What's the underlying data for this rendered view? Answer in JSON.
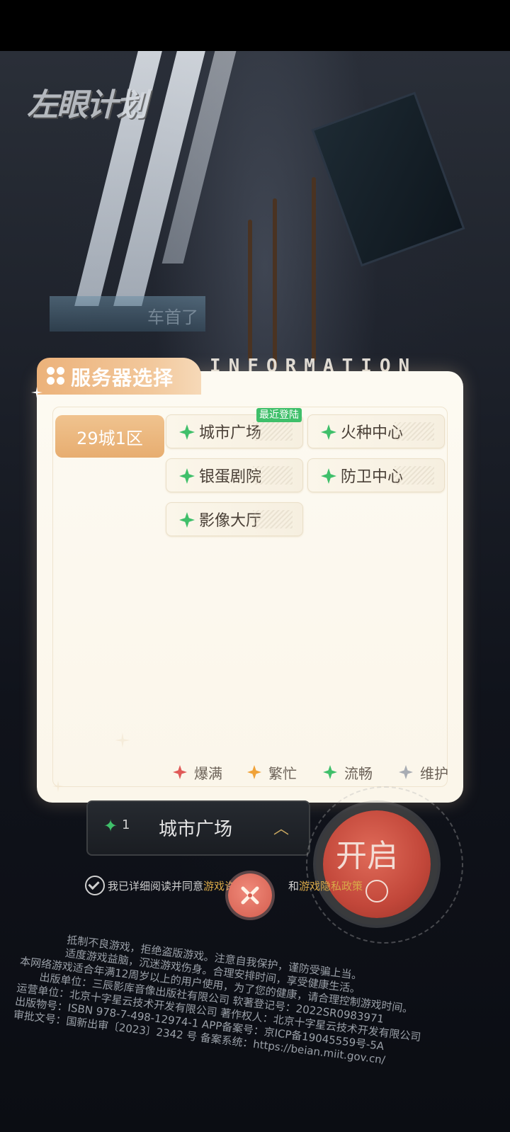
{
  "background": {
    "logo_text": "左眼计划",
    "sign_text": "车首了",
    "info_banner": "INFORMATION"
  },
  "dialog": {
    "title": "服务器选择",
    "region_tab": "29城1区",
    "recent_badge": "最近登陆",
    "servers": [
      {
        "name": "城市广场",
        "status": "流畅"
      },
      {
        "name": "火种中心",
        "status": "流畅"
      },
      {
        "name": "银蛋剧院",
        "status": "流畅"
      },
      {
        "name": "防卫中心",
        "status": "流畅"
      },
      {
        "name": "影像大厅",
        "status": "流畅"
      }
    ],
    "legend": [
      {
        "label": "爆满",
        "color": "#e05a58"
      },
      {
        "label": "繁忙",
        "color": "#f0a238"
      },
      {
        "label": "流畅",
        "color": "#3fbf6a"
      },
      {
        "label": "维护",
        "color": "#a8acb3"
      }
    ]
  },
  "game_ui": {
    "selected_server_num": "1",
    "selected_server": "城市广场",
    "start_button": "开启",
    "consent_prefix": "我已详细阅读并同意",
    "consent_link1": "游戏许可",
    "consent_mid": "和",
    "consent_link2": "游戏隐私政策"
  },
  "footer": {
    "lines": [
      "抵制不良游戏，拒绝盗版游戏。注意自我保护，谨防受骗上当。",
      "适度游戏益脑，沉迷游戏伤身。合理安排时间，享受健康生活。",
      "本网络游戏适合年满12周岁以上的用户使用，为了您的健康，请合理控制游戏时间。",
      "出版单位：三辰影库音像出版社有限公司 软著登记号：2022SR0983971",
      "运营单位：北京十字星云技术开发有限公司 著作权人：北京十字星云技术开发有限公司",
      "出版物号：ISBN 978-7-498-12974-1 APP备案号：京ICP备19045559号-5A",
      "审批文号：国新出审〔2023〕2342 号 备案系统：https://beian.miit.gov.cn/"
    ]
  },
  "colors": {
    "accent": "#ecb27a",
    "status_smooth": "#3fbf6a",
    "start_red": "#c2473a"
  }
}
